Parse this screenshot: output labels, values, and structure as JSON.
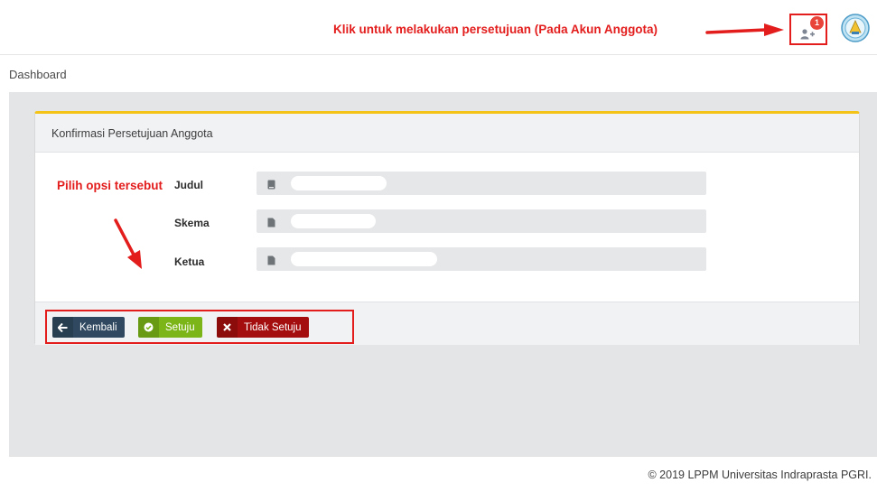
{
  "topbar": {
    "annotation": "Klik untuk melakukan persetujuan (Pada Akun Anggota)",
    "notification_count": "1"
  },
  "breadcrumb": "Dashboard",
  "card": {
    "title": "Konfirmasi Persetujuan Anggota",
    "fields": [
      {
        "label": "Judul",
        "value": ""
      },
      {
        "label": "Skema",
        "value": ""
      },
      {
        "label": "Ketua",
        "value": ""
      }
    ],
    "annotation": "Pilih opsi tersebut",
    "buttons": {
      "back": "Kembali",
      "approve": "Setuju",
      "reject": "Tidak Setuju"
    }
  },
  "footer": {
    "copyright": "© 2019 LPPM Universitas Indraprasta PGRI."
  },
  "colors": {
    "annotation_red": "#e31c1c",
    "card_accent": "#f3c318",
    "back_button": "#304960",
    "approve_button": "#7cb518",
    "reject_button": "#a50e0e",
    "badge": "#e8443a"
  }
}
